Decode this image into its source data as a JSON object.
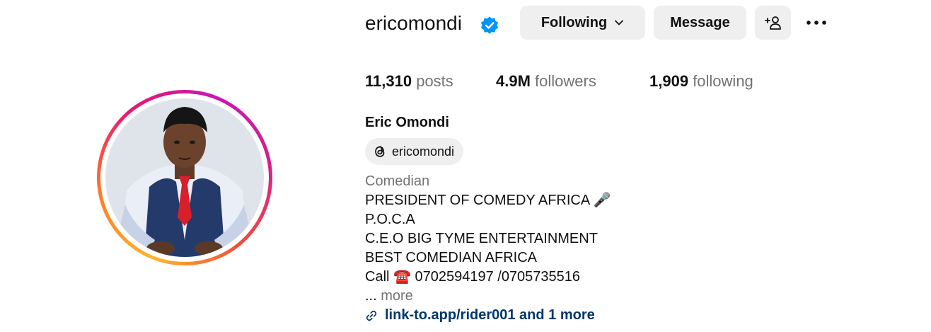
{
  "profile": {
    "username": "ericomondi",
    "verified": true,
    "full_name": "Eric Omondi",
    "threads_handle": "ericomondi",
    "category": "Comedian",
    "bio_lines": [
      "PRESIDENT OF COMEDY AFRICA 🎤",
      "P.O.C.A",
      "C.E.O BIG TYME ENTERTAINMENT",
      "BEST COMEDIAN AFRICA",
      "Call ☎️ 0702594197 /0705735516"
    ],
    "more_prefix": "...",
    "more_label": "more",
    "link_text": "link-to.app/rider001 and 1 more"
  },
  "actions": {
    "following_label": "Following",
    "message_label": "Message"
  },
  "stats": {
    "posts_count": "11,310",
    "posts_label": "posts",
    "followers_count": "4.9M",
    "followers_label": "followers",
    "following_count": "1,909",
    "following_label": "following"
  },
  "colors": {
    "verified_blue": "#0095f6",
    "button_bg": "#efefef",
    "secondary_text": "#737373",
    "link_color": "#00376b"
  },
  "icons": {
    "verified": "verified-badge-icon",
    "chevron": "chevron-down-icon",
    "add_user": "add-user-icon",
    "more": "more-options-icon",
    "threads": "threads-icon",
    "link": "link-icon"
  }
}
